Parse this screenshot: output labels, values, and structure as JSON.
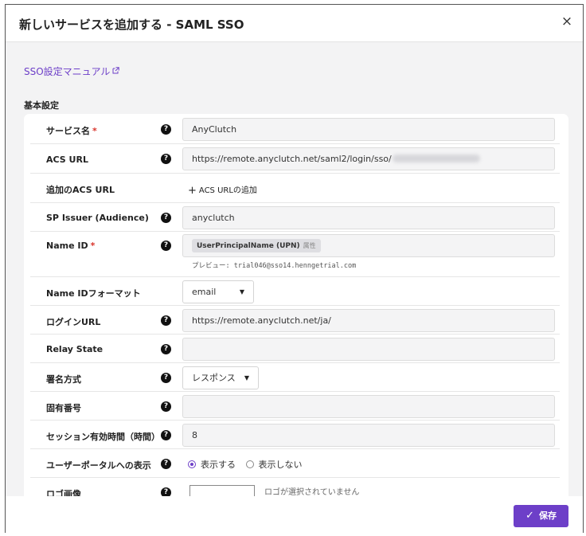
{
  "dialog": {
    "title": "新しいサービスを追加する - SAML SSO",
    "close_glyph": "×"
  },
  "manual_link": {
    "label": "SSO設定マニュアル",
    "icon": "external-link-icon"
  },
  "section_label": "基本設定",
  "help_glyph": "?",
  "required_mark": "*",
  "fields": {
    "service_name": {
      "label": "サービス名",
      "value": "AnyClutch"
    },
    "acs_url": {
      "label": "ACS URL",
      "value": "https://remote.anyclutch.net/saml2/login/sso/"
    },
    "extra_acs": {
      "label": "追加のACS URL",
      "add_label": "ACS URLの追加",
      "plus_glyph": "+"
    },
    "sp_issuer": {
      "label": "SP Issuer (Audience)",
      "value": "anyclutch"
    },
    "name_id": {
      "label": "Name ID",
      "tag": "UserPrincipalName (UPN)",
      "tag_kind": "属性",
      "preview": "プレビュー: trial046@sso14.henngetrial.com"
    },
    "name_id_format": {
      "label": "Name IDフォーマット",
      "selected": "email"
    },
    "login_url": {
      "label": "ログインURL",
      "value": "https://remote.anyclutch.net/ja/"
    },
    "relay_state": {
      "label": "Relay State",
      "value": ""
    },
    "signature": {
      "label": "署名方式",
      "selected": "レスポンス"
    },
    "unique_number": {
      "label": "固有番号",
      "value": ""
    },
    "session_hours": {
      "label": "セッション有効時間（時間）",
      "value": "8"
    },
    "portal_display": {
      "label": "ユーザーポータルへの表示",
      "options": [
        "表示する",
        "表示しない"
      ],
      "selected_index": 0
    },
    "logo": {
      "label": "ロゴ画像",
      "status": "ロゴが選択されていません"
    }
  },
  "caret_glyph": "▼",
  "footer": {
    "save_label": "保存",
    "check_glyph": "✓"
  },
  "colors": {
    "accent": "#6d3fc8",
    "required": "#d9342b",
    "panel_bg": "#f3f3f4"
  }
}
